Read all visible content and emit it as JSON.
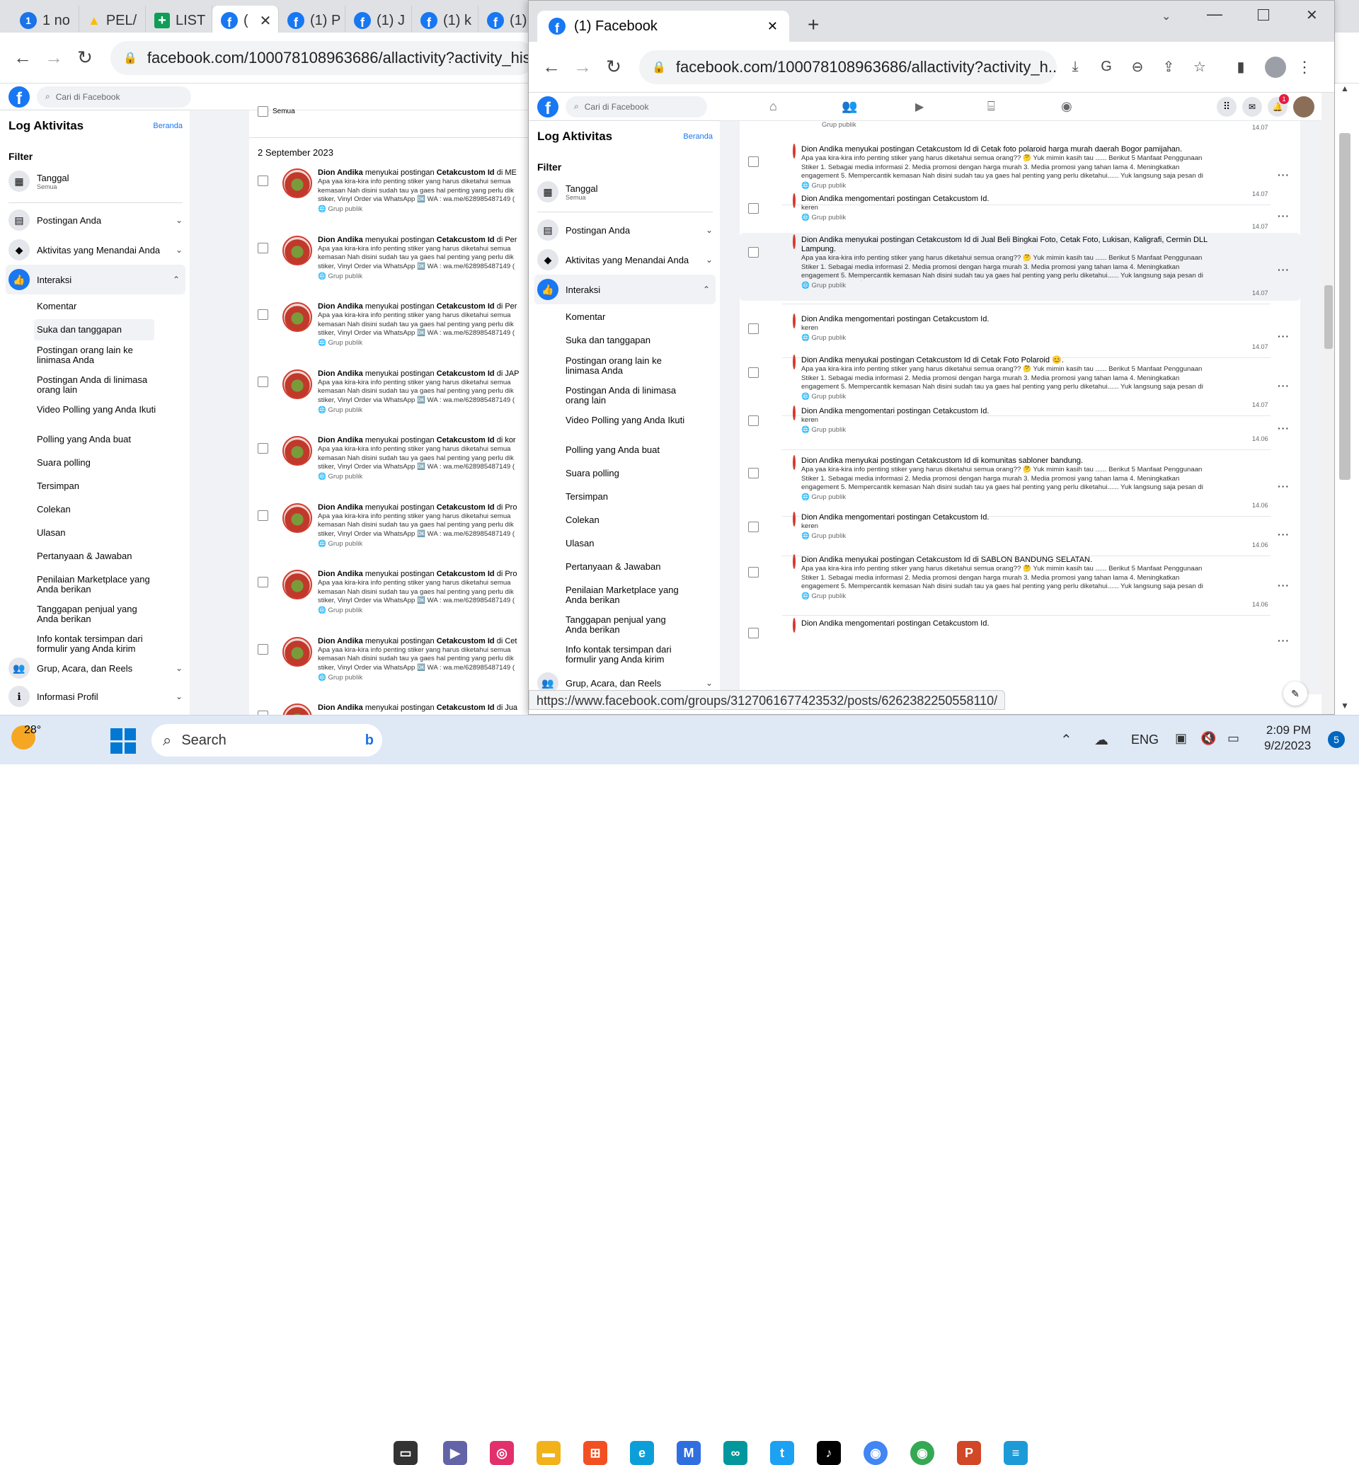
{
  "back": {
    "tabs": [
      "1 no",
      "PEL/",
      "LIST",
      "(",
      "(1) P",
      "(1) J",
      "(1) k",
      "(1)"
    ],
    "url": "facebook.com/100078108963686/allactivity?activity_histo",
    "search_placeholder": "Cari di Facebook",
    "title": "Log Aktivitas",
    "beranda": "Beranda",
    "filter": "Filter",
    "tanggal": "Tanggal",
    "semua": "Semua",
    "cats": [
      "Postingan Anda",
      "Aktivitas yang Menandai Anda",
      "Interaksi"
    ],
    "subs": [
      "Komentar",
      "Suka dan tanggapan",
      "Postingan orang lain ke linimasa Anda",
      "Postingan Anda di linimasa orang lain",
      "Video Polling yang Anda Ikuti",
      "Polling yang Anda buat",
      "Suara polling",
      "Tersimpan",
      "Colekan",
      "Ulasan",
      "Pertanyaan & Jawaban",
      "Penilaian Marketplace yang Anda berikan",
      "Tanggapan penjual yang Anda berikan",
      "Info kontak tersimpan dari formulir yang Anda kirim"
    ],
    "cats2": [
      "Grup, Acara, dan Reels",
      "Informasi Profil"
    ],
    "semua_top": "Semua",
    "date": "2 September 2023",
    "items": [
      {
        "who": "Dion Andika",
        "act": " menyukai postingan ",
        "page": "Cetakcustom Id",
        "where": " di ME"
      },
      {
        "who": "Dion Andika",
        "act": " menyukai postingan ",
        "page": "Cetakcustom Id",
        "where": " di Per"
      },
      {
        "who": "Dion Andika",
        "act": " menyukai postingan ",
        "page": "Cetakcustom Id",
        "where": " di Per"
      },
      {
        "who": "Dion Andika",
        "act": " menyukai postingan ",
        "page": "Cetakcustom Id",
        "where": " di JAP"
      },
      {
        "who": "Dion Andika",
        "act": " menyukai postingan ",
        "page": "Cetakcustom Id",
        "where": " di kor"
      },
      {
        "who": "Dion Andika",
        "act": " menyukai postingan ",
        "page": "Cetakcustom Id",
        "where": " di Pro"
      },
      {
        "who": "Dion Andika",
        "act": " menyukai postingan ",
        "page": "Cetakcustom Id",
        "where": " di Pro"
      },
      {
        "who": "Dion Andika",
        "act": " menyukai postingan ",
        "page": "Cetakcustom Id",
        "where": " di Cet"
      },
      {
        "who": "Dion Andika",
        "act": " menyukai postingan ",
        "page": "Cetakcustom Id",
        "where": " di Jua"
      }
    ],
    "desc": "Apa yaa kira-kira info penting stiker yang harus diketahui semua kemasan Nah disini sudah tau ya gaes hal penting yang perlu dik stiker, Vinyl Order via WhatsApp 🆗 WA : wa.me/628985487149 (",
    "group": "Grup publik"
  },
  "front": {
    "tab": "(1) Facebook",
    "url": "facebook.com/100078108963686/allactivity?activity_h...",
    "search_placeholder": "Cari di Facebook",
    "notif": "1",
    "title": "Log Aktivitas",
    "beranda": "Beranda",
    "filter": "Filter",
    "tanggal": "Tanggal",
    "semua": "Semua",
    "cats": [
      "Postingan Anda",
      "Aktivitas yang Menandai Anda",
      "Interaksi"
    ],
    "subs": [
      "Komentar",
      "Suka dan tanggapan",
      "Postingan orang lain ke linimasa Anda",
      "Postingan Anda di linimasa orang lain",
      "Video Polling yang Anda Ikuti",
      "Polling yang Anda buat",
      "Suara polling",
      "Tersimpan",
      "Colekan",
      "Ulasan",
      "Pertanyaan & Jawaban",
      "Penilaian Marketplace yang Anda berikan",
      "Tanggapan penjual yang Anda berikan",
      "Info kontak tersimpan dari formulir yang Anda kirim"
    ],
    "cats2": [
      "Grup, Acara, dan Reels"
    ],
    "top_group": "Grup publik",
    "top_time": "14.07",
    "items": [
      {
        "title": "Dion Andika menyukai postingan Cetakcustom Id di Cetak foto polaroid harga murah daerah Bogor pamijahan.",
        "desc": "Apa yaa kira-kira info penting stiker yang harus diketahui semua orang?? 🤔 Yuk mimin kasih tau ...... Berikut 5 Manfaat Penggunaan Stiker 1. Sebagai media informasi 2. Media promosi dengan harga murah 3. Media promosi yang tahan lama 4. Meningkatkan engagement 5. Mempercantik kemasan Nah disini sudah tau ya gaes hal penting yang perlu diketahui...... Yuk langsung saja pesan di Cetak Custom Id 🛒",
        "group": "Grup publik",
        "time": "14.07"
      },
      {
        "title": "Dion Andika mengomentari postingan Cetakcustom Id.",
        "desc": "keren",
        "group": "Grup publik",
        "time": "14.07"
      },
      {
        "title": "Dion Andika menyukai postingan Cetakcustom Id di Jual Beli Bingkai Foto, Cetak Foto, Lukisan, Kaligrafi, Cermin DLL Lampung.",
        "desc": "Apa yaa kira-kira info penting stiker yang harus diketahui semua orang?? 🤔 Yuk mimin kasih tau ...... Berikut 5 Manfaat Penggunaan Stiker 1. Sebagai media informasi 2. Media promosi dengan harga murah 3. Media promosi yang tahan lama 4. Meningkatkan engagement 5. Mempercantik kemasan Nah disini sudah tau ya gaes hal penting yang perlu diketahui...... Yuk langsung saja pesan di Cetak Custom Id 🛒",
        "group": "Grup publik",
        "time": "14.07"
      },
      {
        "title": "Dion Andika mengomentari postingan Cetakcustom Id.",
        "desc": "keren",
        "group": "Grup publik",
        "time": "14.07"
      },
      {
        "title": "Dion Andika menyukai postingan Cetakcustom Id di Cetak Foto Polaroid 😊.",
        "desc": "Apa yaa kira-kira info penting stiker yang harus diketahui semua orang?? 🤔 Yuk mimin kasih tau ...... Berikut 5 Manfaat Penggunaan Stiker 1. Sebagai media informasi 2. Media promosi dengan harga murah 3. Media promosi yang tahan lama 4. Meningkatkan engagement 5. Mempercantik kemasan Nah disini sudah tau ya gaes hal penting yang perlu diketahui...... Yuk langsung saja pesan di Cetak Custom Id 🛒",
        "group": "Grup publik",
        "time": "14.07"
      },
      {
        "title": "Dion Andika mengomentari postingan Cetakcustom Id.",
        "desc": "keren",
        "group": "Grup publik",
        "time": "14.06"
      },
      {
        "title": "Dion Andika menyukai postingan Cetakcustom Id di komunitas sabloner bandung.",
        "desc": "Apa yaa kira-kira info penting stiker yang harus diketahui semua orang?? 🤔 Yuk mimin kasih tau ...... Berikut 5 Manfaat Penggunaan Stiker 1. Sebagai media informasi 2. Media promosi dengan harga murah 3. Media promosi yang tahan lama 4. Meningkatkan engagement 5. Mempercantik kemasan Nah disini sudah tau ya gaes hal penting yang perlu diketahui...... Yuk langsung saja pesan di Cetak Custom Id 🛒",
        "group": "Grup publik",
        "time": "14.06"
      },
      {
        "title": "Dion Andika mengomentari postingan Cetakcustom Id.",
        "desc": "keren",
        "group": "Grup publik",
        "time": "14.06"
      },
      {
        "title": "Dion Andika menyukai postingan Cetakcustom Id di SABLON BANDUNG SELATAN.",
        "desc": "Apa yaa kira-kira info penting stiker yang harus diketahui semua orang?? 🤔 Yuk mimin kasih tau ...... Berikut 5 Manfaat Penggunaan Stiker 1. Sebagai media informasi 2. Media promosi dengan harga murah 3. Media promosi yang tahan lama 4. Meningkatkan engagement 5. Mempercantik kemasan Nah disini sudah tau ya gaes hal penting yang perlu diketahui...... Yuk langsung saja pesan di Cetak Custom Id 🛒",
        "group": "Grup publik",
        "time": "14.06"
      },
      {
        "title": "Dion Andika mengomentari postingan Cetakcustom Id.",
        "desc": "",
        "group": "",
        "time": ""
      }
    ],
    "status_url": "https://www.facebook.com/groups/3127061677423532/posts/6262382250558110/"
  },
  "taskbar": {
    "temp": "28°",
    "search": "Search",
    "lang": "ENG",
    "time": "2:09 PM",
    "date": "9/2/2023",
    "notif": "5"
  }
}
